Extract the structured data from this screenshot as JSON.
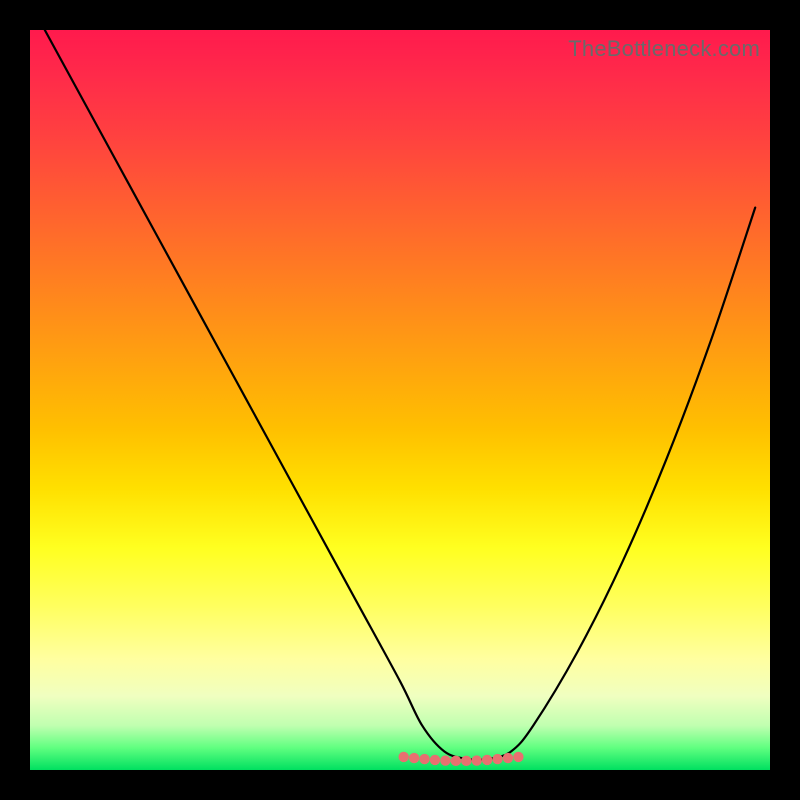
{
  "watermark": "TheBottleneck.com",
  "chart_data": {
    "type": "line",
    "title": "",
    "xlabel": "",
    "ylabel": "",
    "xlim": [
      0,
      100
    ],
    "ylim": [
      0,
      100
    ],
    "grid": false,
    "legend": false,
    "series": [
      {
        "name": "curve",
        "x": [
          2,
          8,
          14,
          20,
          26,
          32,
          38,
          44,
          50,
          53,
          56,
          59,
          62,
          65,
          68,
          74,
          80,
          86,
          92,
          98
        ],
        "y": [
          100,
          89,
          78,
          67,
          56,
          45,
          34,
          23,
          12,
          6,
          2.5,
          1.5,
          1.5,
          2.5,
          6,
          16,
          28,
          42,
          58,
          76
        ],
        "color": "#000000"
      }
    ],
    "annotations": [
      {
        "type": "dot-line",
        "color": "#e87070",
        "y": 1.5,
        "x_start": 50.5,
        "x_end": 66,
        "dot_count": 12
      }
    ],
    "background": {
      "gradient_direction": "vertical",
      "stops": [
        {
          "pos": 0.0,
          "color": "#ff1a4d"
        },
        {
          "pos": 0.5,
          "color": "#ffb000"
        },
        {
          "pos": 0.72,
          "color": "#ffff30"
        },
        {
          "pos": 0.92,
          "color": "#e8ffc0"
        },
        {
          "pos": 1.0,
          "color": "#00e060"
        }
      ]
    }
  }
}
